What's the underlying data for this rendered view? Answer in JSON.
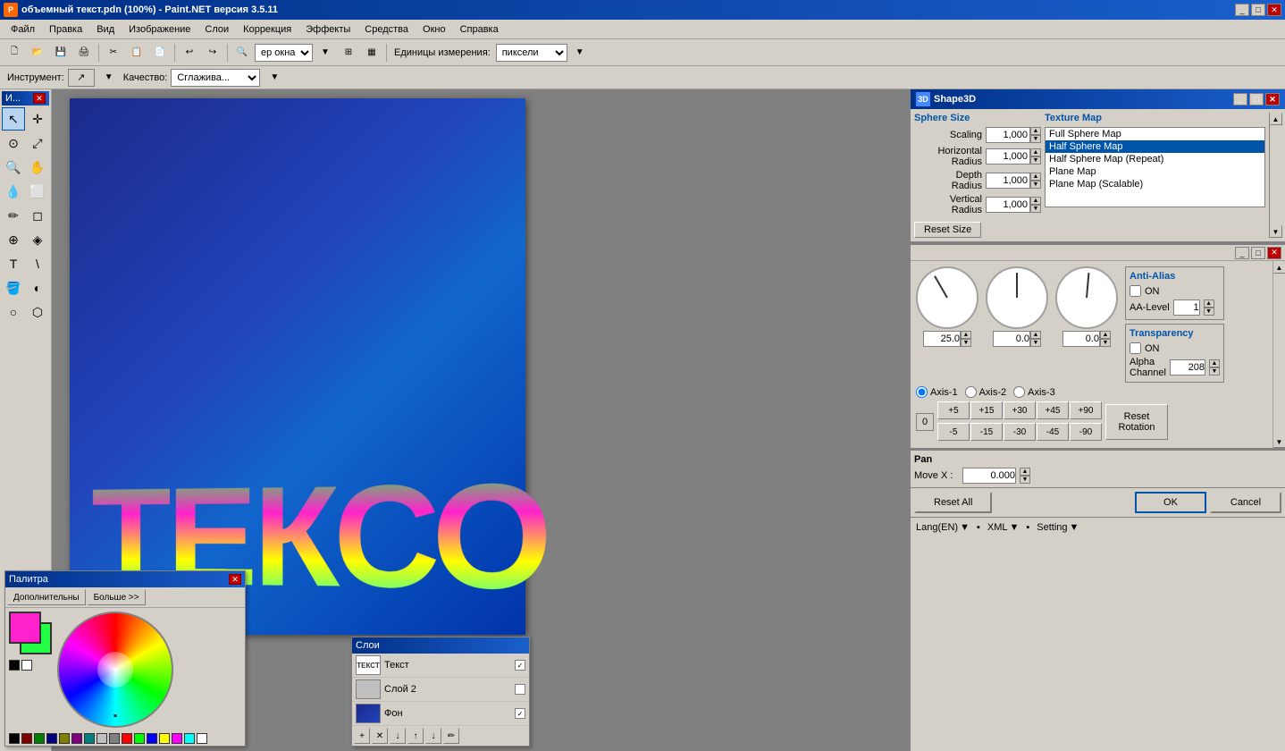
{
  "titleBar": {
    "icon": "PDN",
    "title": "объемный текст.pdn (100%) - Paint.NET версия 3.5.11",
    "buttons": [
      "_",
      "□",
      "✕"
    ]
  },
  "menuBar": {
    "items": [
      "Файл",
      "Правка",
      "Вид",
      "Изображение",
      "Слои",
      "Коррекция",
      "Эффекты",
      "Средства",
      "Окно",
      "Справка"
    ]
  },
  "toolbar": {
    "zoomValue": "ер окна",
    "unitsLabel": "Единицы измерения:",
    "unitsValue": "пиксели"
  },
  "toolBar": {
    "instrumentLabel": "Инструмент:",
    "qualityLabel": "Качество:",
    "qualityValue": "Сглажива..."
  },
  "shape3d": {
    "title": "Shape3D",
    "sphereSize": {
      "title": "Sphere Size",
      "scaling": {
        "label": "Scaling",
        "value": "1,000"
      },
      "horizontalRadius": {
        "label": "Horizontal\nRadius",
        "value": "1,000"
      },
      "depthRadius": {
        "label": "Depth\nRadius",
        "value": "1,000"
      },
      "verticalRadius": {
        "label": "Vertical\nRadius",
        "value": "1,000"
      },
      "resetBtn": "Reset Size"
    },
    "textureMap": {
      "title": "Texture Map",
      "items": [
        {
          "label": "Full Sphere Map",
          "selected": false
        },
        {
          "label": "Half Sphere Map",
          "selected": true
        },
        {
          "label": "Half Sphere Map (Repeat)",
          "selected": false
        },
        {
          "label": "Plane Map",
          "selected": false
        },
        {
          "label": "Plane Map (Scalable)",
          "selected": false
        }
      ]
    },
    "rotation": {
      "dial1Value": "25.0",
      "dial2Value": "0.0",
      "dial3Value": "0.0",
      "axes": [
        {
          "label": "Axis-1",
          "selected": true
        },
        {
          "label": "Axis-2",
          "selected": false
        },
        {
          "label": "Axis-3",
          "selected": false
        }
      ],
      "zeroBtn": "0",
      "stepButtons": [
        "+5",
        "+15",
        "+30",
        "+45",
        "+90",
        "-5",
        "-15",
        "-30",
        "-45",
        "-90"
      ],
      "resetRotationBtn": "Reset\nRotation"
    },
    "antiAlias": {
      "title": "Anti-Alias",
      "onLabel": "ON",
      "aaLevelLabel": "AA-Level",
      "aaLevelValue": "1"
    },
    "transparency": {
      "title": "Transparency",
      "onLabel": "ON",
      "alphaChannelLabel": "Alpha\nChannel",
      "alphaChannelValue": "208"
    },
    "pan": {
      "title": "Pan",
      "moveXLabel": "Move X :",
      "moveXValue": "0.000"
    },
    "bottomButtons": {
      "resetAll": "Reset All",
      "ok": "OK",
      "cancel": "Cancel"
    },
    "langBar": {
      "lang": "Lang(EN)",
      "xml": "XML",
      "setting": "Setting"
    }
  },
  "palette": {
    "title": "Палитра",
    "buttons": [
      "Дополнительны",
      "Больше >>"
    ],
    "fgColor": "#ff22cc",
    "bgColor": "#22ff44",
    "smallColors": [
      "#000000",
      "#ffffff"
    ],
    "bottomColors": [
      "#000000",
      "#800000",
      "#008000",
      "#000080",
      "#808000",
      "#800080",
      "#008080",
      "#c0c0c0",
      "#808080",
      "#ff0000",
      "#00ff00",
      "#0000ff",
      "#ffff00",
      "#ff00ff",
      "#00ffff",
      "#ffffff"
    ]
  },
  "layers": {
    "items": [
      {
        "name": "Текст",
        "visible": true,
        "type": "text"
      },
      {
        "name": "Слой 2",
        "visible": false,
        "type": "text2"
      },
      {
        "name": "Фон",
        "visible": true,
        "type": "blue"
      }
    ],
    "actions": [
      "+",
      "🗑",
      "↓",
      "↑",
      "↓",
      "✏"
    ]
  }
}
